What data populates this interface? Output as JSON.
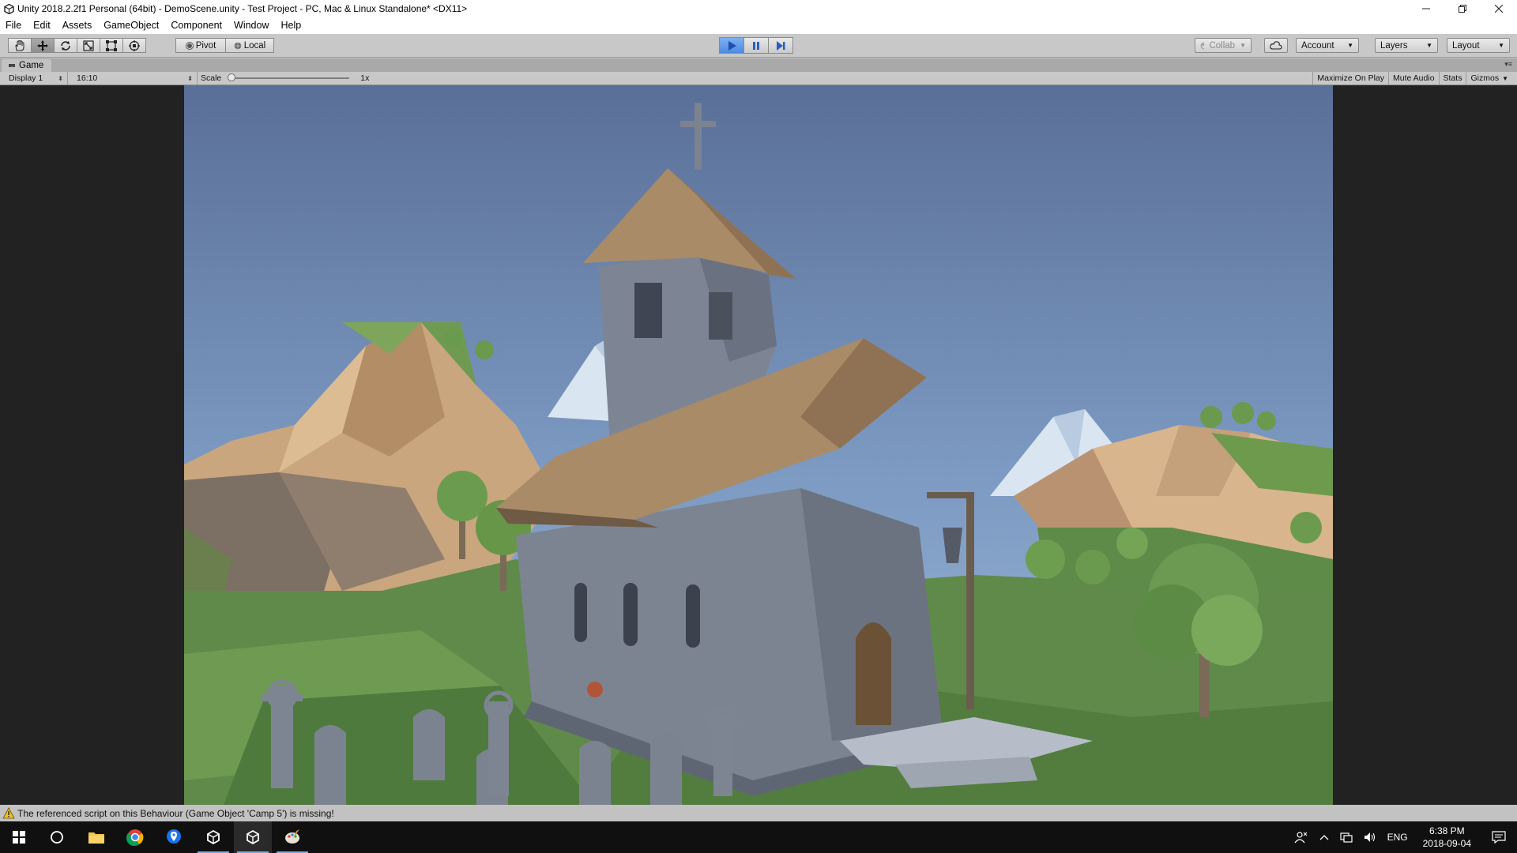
{
  "window": {
    "title": "Unity 2018.2.2f1 Personal (64bit) - DemoScene.unity - Test Project - PC, Mac & Linux Standalone* <DX11>",
    "controls": [
      "minimize-icon",
      "restore-icon",
      "close-icon"
    ]
  },
  "menu": {
    "items": [
      "File",
      "Edit",
      "Assets",
      "GameObject",
      "Component",
      "Window",
      "Help"
    ]
  },
  "toolbar": {
    "tools": [
      "hand-tool-icon",
      "move-tool-icon",
      "rotate-tool-icon",
      "scale-tool-icon",
      "rect-tool-icon",
      "transform-tool-icon"
    ],
    "active_tool": "move-tool-icon",
    "pivot_label": "Pivot",
    "local_label": "Local",
    "play_state": "playing",
    "collab_label": "Collab",
    "account_label": "Account",
    "layers_label": "Layers",
    "layout_label": "Layout"
  },
  "game_view": {
    "tab_label": "Game",
    "display_label": "Display 1",
    "aspect_label": "16:10",
    "scale_label": "Scale",
    "scale_value": "1x",
    "scale_fraction": 0.0,
    "maximize_label": "Maximize On Play",
    "mute_label": "Mute Audio",
    "stats_label": "Stats",
    "gizmos_label": "Gizmos"
  },
  "console": {
    "message": "The referenced script on this Behaviour (Game Object 'Camp 5') is missing!",
    "level": "warning"
  },
  "taskbar": {
    "apps": [
      "windows-start-icon",
      "cortana-search-icon",
      "file-explorer-icon",
      "chrome-icon",
      "maps-icon",
      "unity-hub-icon",
      "unity-editor-icon",
      "paint-icon"
    ],
    "language": "ENG",
    "time": "6:38 PM",
    "date": "2018-09-04"
  },
  "colors": {
    "sky_top": "#5b7199",
    "sky_bottom": "#8aa9cc",
    "grass": "#5f8a4a",
    "stone": "#7a818f",
    "roof": "#a88b68",
    "play_accent": "#4d8ae0"
  }
}
